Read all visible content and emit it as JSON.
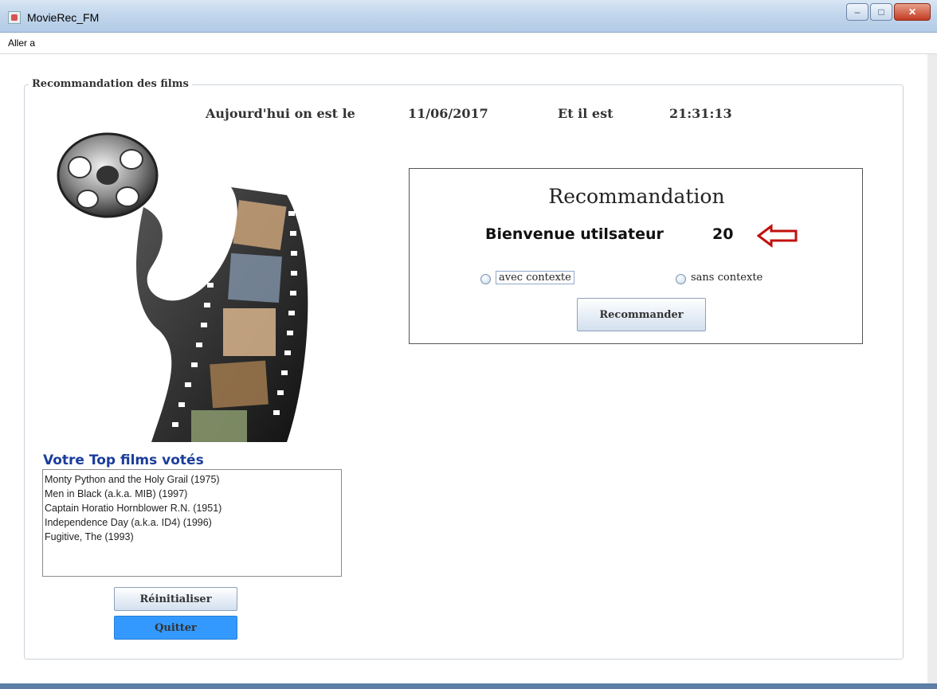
{
  "window": {
    "title": "MovieRec_FM",
    "controls": {
      "minimize": "–",
      "maximize": "□",
      "close": "✕"
    }
  },
  "menu": {
    "items": [
      "Aller a"
    ]
  },
  "group": {
    "title": "Recommandation des films"
  },
  "header": {
    "date_label": "Aujourd'hui on est le",
    "date_value": "11/06/2017",
    "time_label": "Et il est",
    "time_value": "21:31:13"
  },
  "recommendation": {
    "title": "Recommandation",
    "welcome_label": "Bienvenue utilsateur",
    "user_id": "20",
    "options": [
      "avec contexte",
      "sans contexte"
    ],
    "button_label": "Recommander",
    "arrow_color": "#c0100f"
  },
  "top_films": {
    "title": "Votre Top films votés",
    "items": [
      "Monty Python and the Holy Grail (1975)",
      "Men in Black (a.k.a. MIB) (1997)",
      "Captain Horatio Hornblower R.N. (1951)",
      "Independence Day (a.k.a. ID4) (1996)",
      "Fugitive, The (1993)"
    ]
  },
  "actions": {
    "reset_label": "Réinitialiser",
    "quit_label": "Quitter"
  },
  "colors": {
    "quit_button": "#3399ff",
    "top_title": "#1a3d9c"
  }
}
